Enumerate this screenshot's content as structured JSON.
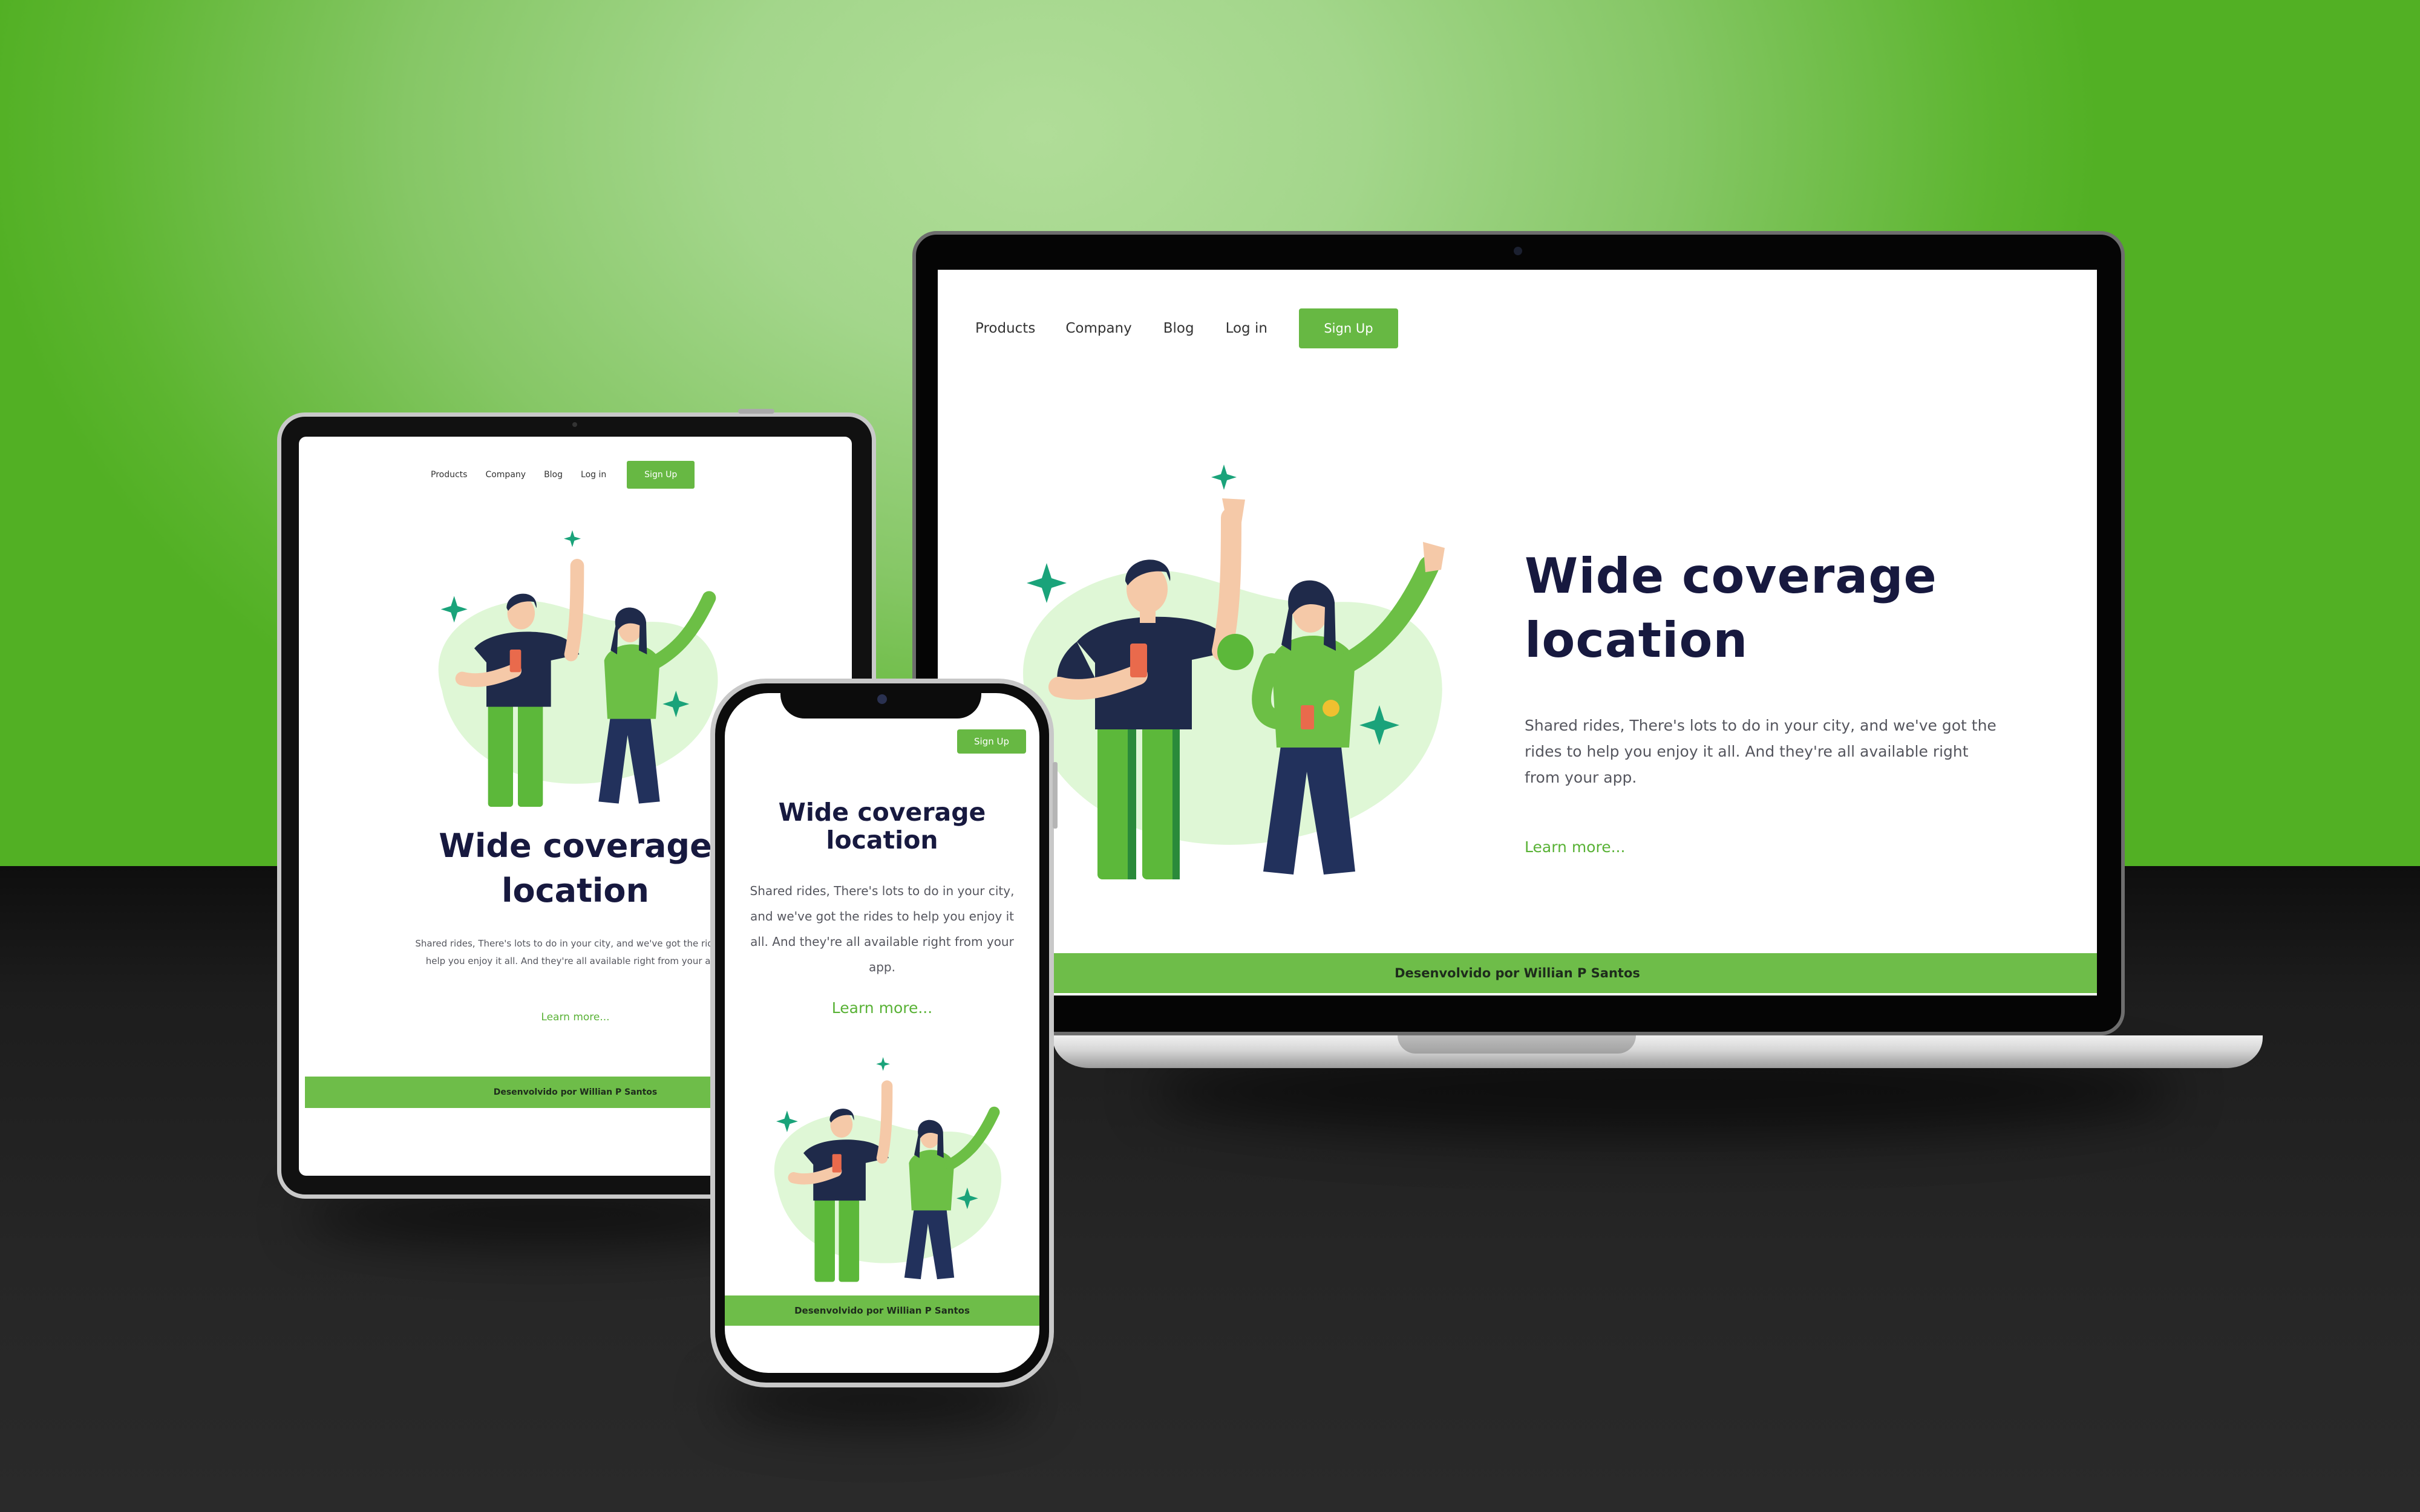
{
  "site": {
    "nav": [
      "Products",
      "Company",
      "Blog",
      "Log in"
    ],
    "signup_label": "Sign Up",
    "title_line1": "Wide coverage",
    "title_line2": "location",
    "description": "Shared rides, There's lots to do in your city, and we've got the rides to help you enjoy it all. And they're all available right from your app.",
    "learn_more": "Learn more...",
    "footer": "Desenvolvido por Willian P Santos"
  },
  "colors": {
    "accent": "#67b843",
    "title": "#17193f",
    "illustration_blob": "#dff7d6",
    "sparkle": "#1aa37a",
    "shirt_dark": "#1f2a4a",
    "shirt_green": "#6cbf45"
  },
  "icons": [
    "sparkle-icon",
    "camera-icon"
  ]
}
